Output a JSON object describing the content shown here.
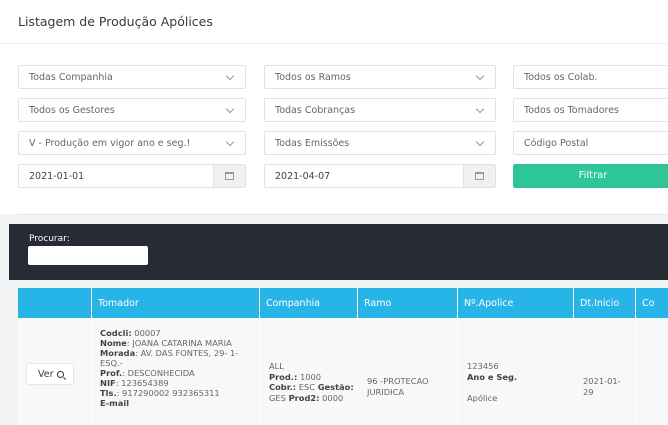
{
  "page": {
    "title": "Listagem de Produção Apólices"
  },
  "filters": {
    "companhia": "Todas Companhia",
    "ramos": "Todos os Ramos",
    "colab": "Todos os Colab.",
    "gestores": "Todos os Gestores",
    "cobrancas": "Todas Cobranças",
    "tomadores": "Todos os Tomadores",
    "producao": "V - Produção em vigor ano e seg.!",
    "emissoes": "Todas Emissões",
    "codigo_postal_placeholder": "Código Postal",
    "date_from": "2021-01-01",
    "date_to": "2021-04-07",
    "filter_button": "Filtrar"
  },
  "search": {
    "label": "Procurar:",
    "value": ""
  },
  "table": {
    "headers": [
      "",
      "Tomador",
      "Companhia",
      "Ramo",
      "Nº.Apolice",
      "Dt.Inicio",
      "Co"
    ],
    "rows": [
      {
        "view_button": "Ver",
        "tomador": {
          "codcli_label": "Codcli:",
          "codcli": "00007",
          "nome_label": "Nome",
          "nome": ": JOANA CATARINA MARIA",
          "morada_label": "Morada",
          "morada_1": ": AV. DAS FONTES, 29- 1-",
          "morada_2": "ESQ.-",
          "prof_label": "Prof.",
          "prof": ": DESCONHECIDA",
          "nif_label": "NIF",
          "nif": ": 123654389",
          "tls_label": "Tls.",
          "tls": ": 917290002 932365311",
          "more": "E-mail"
        },
        "companhia": {
          "name": "ALL",
          "prod_label": "Prod.:",
          "prod": "1000",
          "cobr_label": "Cobr.:",
          "cobr": "ESC",
          "gestao_label": "Gestão:",
          "gestao": "GES",
          "prod2_label": "Prod2:",
          "prod2": "0000"
        },
        "ramo": {
          "line1": "96 -PROTECAO",
          "line2": "JURIDICA"
        },
        "apolice": {
          "numero": "123456",
          "ano_seg_label": "Ano e Seg.",
          "tipo": "Apólice"
        },
        "dt_inicio": {
          "line1": "2021-01-",
          "line2": "29"
        }
      }
    ]
  }
}
